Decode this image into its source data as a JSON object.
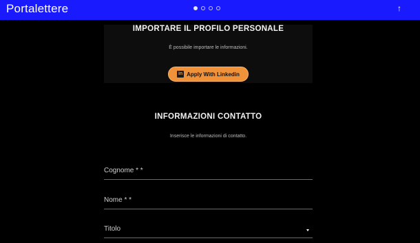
{
  "header": {
    "brand": "Portalettere",
    "carousel_dots": 4,
    "active_dot": 0,
    "scroll_top_icon": "arrow-up-icon",
    "scroll_top_glyph": "↑",
    "color": "#1a1aff"
  },
  "import_section": {
    "title": "IMPORTARE IL PROFILO PERSONALE",
    "description": "È possibile importare le informazioni.",
    "linkedin_button": {
      "icon": "linkedin-icon",
      "icon_glyph": "in",
      "label": "Apply With Linkedin",
      "color": "#f0923a"
    }
  },
  "contact_section": {
    "title": "INFORMAZIONI CONTATTO",
    "description": "Inserisce le informazioni di contatto.",
    "fields": [
      {
        "label": "Cognome * *",
        "type": "text"
      },
      {
        "label": "Nome * *",
        "type": "text"
      },
      {
        "label": "Titolo",
        "type": "select"
      }
    ]
  }
}
